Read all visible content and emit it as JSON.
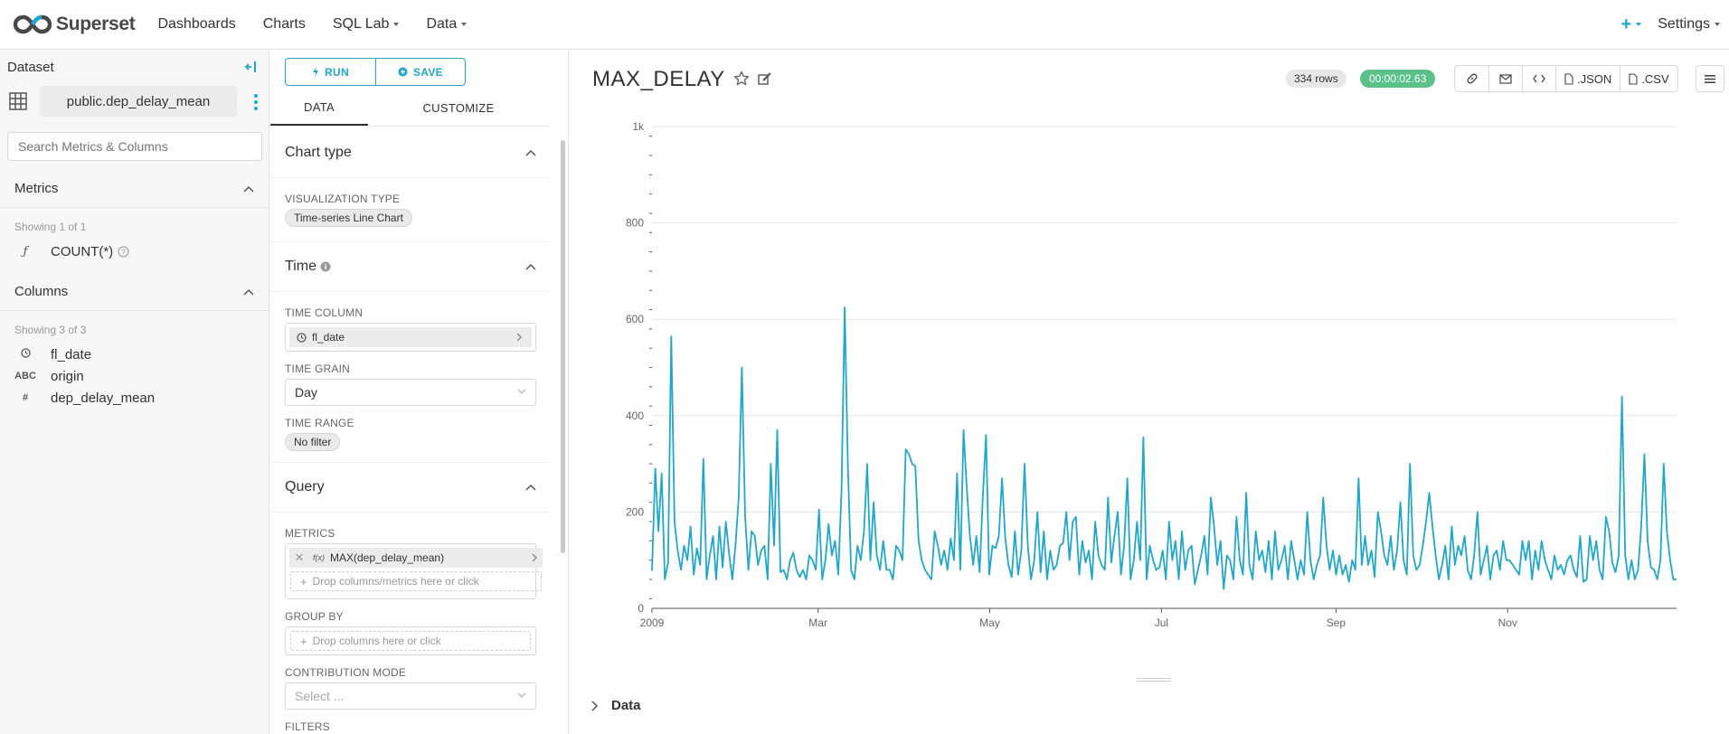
{
  "nav": {
    "brand": "Superset",
    "items": [
      {
        "label": "Dashboards",
        "dropdown": false
      },
      {
        "label": "Charts",
        "dropdown": false
      },
      {
        "label": "SQL Lab",
        "dropdown": true
      },
      {
        "label": "Data",
        "dropdown": true
      }
    ],
    "plus": "+",
    "settings": "Settings"
  },
  "dataset": {
    "header": "Dataset",
    "name": "public.dep_delay_mean",
    "search_placeholder": "Search Metrics & Columns",
    "metrics": {
      "title": "Metrics",
      "showing": "Showing 1 of 1",
      "items": [
        {
          "type": "ƒ",
          "name": "COUNT(*)"
        }
      ]
    },
    "columns": {
      "title": "Columns",
      "showing": "Showing 3 of 3",
      "items": [
        {
          "type": "clock",
          "name": "fl_date"
        },
        {
          "type": "ABC",
          "name": "origin"
        },
        {
          "type": "#",
          "name": "dep_delay_mean"
        }
      ]
    }
  },
  "controls": {
    "run": "RUN",
    "save": "SAVE",
    "tabs": [
      "DATA",
      "CUSTOMIZE"
    ],
    "chart_type": {
      "title": "Chart type",
      "viz_label": "VISUALIZATION TYPE",
      "viz_value": "Time-series Line Chart"
    },
    "time": {
      "title": "Time",
      "column_label": "TIME COLUMN",
      "column_value": "fl_date",
      "grain_label": "TIME GRAIN",
      "grain_value": "Day",
      "range_label": "TIME RANGE",
      "range_value": "No filter"
    },
    "query": {
      "title": "Query",
      "metrics_label": "METRICS",
      "metric_value": "MAX(dep_delay_mean)",
      "metric_fx": "f(x)",
      "metrics_drop": "Drop columns/metrics here or click",
      "groupby_label": "GROUP BY",
      "groupby_drop": "Drop columns here or click",
      "contribution_label": "CONTRIBUTION MODE",
      "contribution_placeholder": "Select ...",
      "filters_label": "FILTERS"
    }
  },
  "chart": {
    "title": "MAX_DELAY",
    "rows": "334 rows",
    "elapsed": "00:00:02.63",
    "actions": [
      ".JSON",
      ".CSV"
    ],
    "data_section": "Data",
    "line_color": "#20a7c9"
  },
  "chart_data": {
    "type": "line",
    "title": "",
    "xlabel": "",
    "ylabel": "",
    "ylim": [
      0,
      1000
    ],
    "y_ticks": [
      "0",
      "200",
      "400",
      "600",
      "800",
      "1k"
    ],
    "x_ticks": [
      "2009",
      "Mar",
      "May",
      "Jul",
      "Sep",
      "Nov"
    ],
    "x_tick_days": [
      0,
      59,
      120,
      181,
      243,
      304
    ],
    "x_range_days": [
      0,
      364
    ],
    "series": [
      {
        "name": "",
        "values": [
          78,
          290,
          160,
          280,
          60,
          95,
          565,
          180,
          120,
          80,
          130,
          100,
          170,
          70,
          125,
          90,
          310,
          60,
          110,
          150,
          60,
          170,
          85,
          180,
          115,
          60,
          130,
          230,
          500,
          190,
          80,
          160,
          150,
          90,
          120,
          130,
          60,
          300,
          130,
          370,
          75,
          80,
          60,
          100,
          115,
          80,
          65,
          80,
          60,
          110,
          100,
          80,
          205,
          60,
          100,
          175,
          110,
          140,
          70,
          245,
          625,
          290,
          80,
          60,
          130,
          100,
          160,
          300,
          100,
          220,
          110,
          80,
          140,
          80,
          80,
          60,
          130,
          120,
          100,
          330,
          320,
          300,
          295,
          140,
          100,
          80,
          70,
          60,
          160,
          130,
          90,
          120,
          80,
          145,
          100,
          280,
          80,
          370,
          250,
          150,
          90,
          150,
          75,
          230,
          360,
          70,
          130,
          125,
          150,
          270,
          145,
          90,
          65,
          160,
          70,
          120,
          300,
          130,
          60,
          100,
          200,
          75,
          160,
          60,
          120,
          80,
          90,
          130,
          135,
          200,
          100,
          180,
          190,
          70,
          140,
          95,
          120,
          60,
          180,
          110,
          90,
          80,
          230,
          95,
          150,
          200,
          70,
          130,
          270,
          60,
          100,
          180,
          100,
          355,
          60,
          130,
          100,
          80,
          85,
          120,
          60,
          180,
          100,
          140,
          60,
          160,
          80,
          120,
          130,
          50,
          80,
          110,
          150,
          70,
          230,
          170,
          90,
          140,
          40,
          110,
          100,
          60,
          190,
          100,
          70,
          240,
          90,
          60,
          160,
          100,
          120,
          75,
          140,
          60,
          160,
          80,
          100,
          130,
          60,
          140,
          100,
          60,
          100,
          70,
          200,
          100,
          60,
          90,
          110,
          230,
          130,
          80,
          120,
          70,
          110,
          70,
          90,
          55,
          100,
          80,
          270,
          90,
          150,
          90,
          120,
          65,
          200,
          160,
          110,
          90,
          150,
          80,
          120,
          220,
          100,
          70,
          300,
          110,
          80,
          90,
          130,
          180,
          240,
          170,
          110,
          60,
          90,
          130,
          60,
          170,
          90,
          130,
          110,
          150,
          80,
          60,
          110,
          200,
          70,
          100,
          130,
          60,
          110,
          120,
          80,
          140,
          100,
          100,
          90,
          80,
          70,
          140,
          100,
          140,
          60,
          120,
          80,
          140,
          100,
          80,
          60,
          110,
          80,
          90,
          70,
          100,
          110,
          80,
          65,
          150,
          55,
          60,
          150,
          100,
          140,
          80,
          60,
          190,
          160,
          95,
          75,
          110,
          440,
          110,
          60,
          100,
          60,
          80,
          170,
          320,
          140,
          85,
          80,
          60,
          100,
          300,
          160,
          100,
          60,
          60
        ]
      }
    ]
  }
}
